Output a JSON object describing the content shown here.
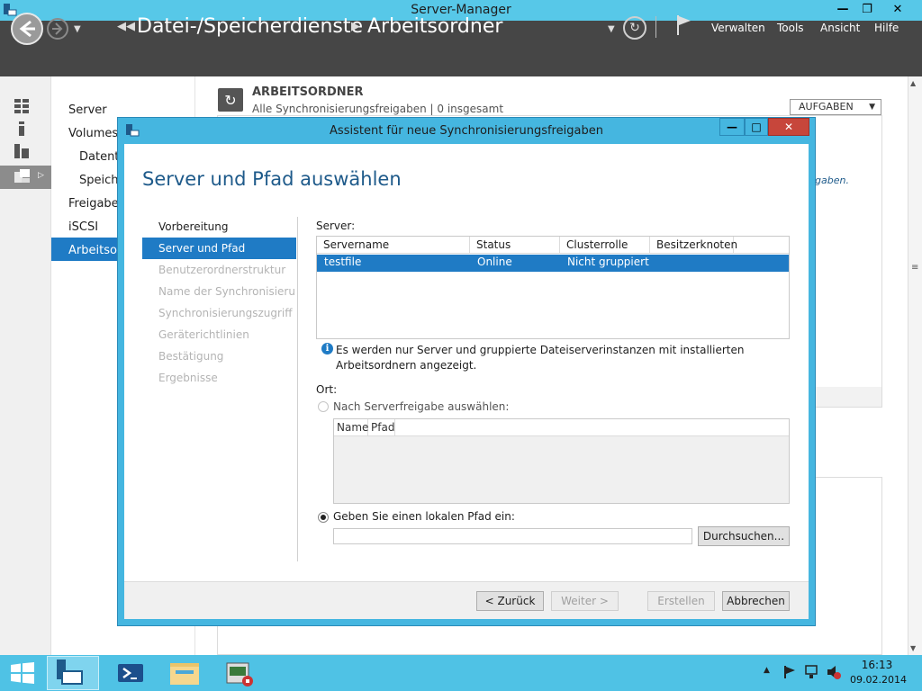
{
  "window": {
    "title": "Server-Manager"
  },
  "header": {
    "breadcrumb_part1": "Datei-/Speicherdienste",
    "breadcrumb_part2": "Arbeitsordner",
    "menu": {
      "manage": "Verwalten",
      "tools": "Tools",
      "view": "Ansicht",
      "help": "Hilfe"
    }
  },
  "nav": {
    "items": [
      "Server",
      "Volumes",
      "Datent",
      "Speich",
      "Freigabe",
      "iSCSI",
      "Arbeitsor"
    ]
  },
  "main": {
    "title": "ARBEITSORDNER",
    "subtitle": "Alle Synchronisierungsfreigaben | 0 insgesamt",
    "tasks_label": "AUFGABEN",
    "link_fragment": "igaben."
  },
  "dialog": {
    "title": "Assistent für neue Synchronisierungsfreigaben",
    "heading": "Server und Pfad auswählen",
    "steps": [
      "Vorbereitung",
      "Server und Pfad",
      "Benutzerordnerstruktur",
      "Name der Synchronisieru...",
      "Synchronisierungszugriff",
      "Geräterichtlinien",
      "Bestätigung",
      "Ergebnisse"
    ],
    "server_label": "Server:",
    "columns": [
      "Servername",
      "Status",
      "Clusterrolle",
      "Besitzerknoten"
    ],
    "row": {
      "name": "testfile",
      "status": "Online",
      "cluster": "Nicht gruppiert",
      "owner": ""
    },
    "info": "Es werden nur Server und gruppierte Dateiserverinstanzen mit installierten Arbeitsordnern angezeigt.",
    "location_label": "Ort:",
    "option_share": "Nach Serverfreigabe auswählen:",
    "share_columns": [
      "Name",
      "Pfad"
    ],
    "option_local": "Geben Sie einen lokalen Pfad ein:",
    "path_value": "",
    "buttons": {
      "browse": "Durchsuchen...",
      "back": "< Zurück",
      "next": "Weiter >",
      "create": "Erstellen",
      "cancel": "Abbrechen"
    }
  },
  "taskbar": {
    "time": "16:13",
    "date": "09.02.2014"
  },
  "colors": {
    "accent": "#1f7bc5",
    "window_frame": "#45b6e0",
    "header_bg": "#464646",
    "taskbar": "#4fc2e5"
  }
}
